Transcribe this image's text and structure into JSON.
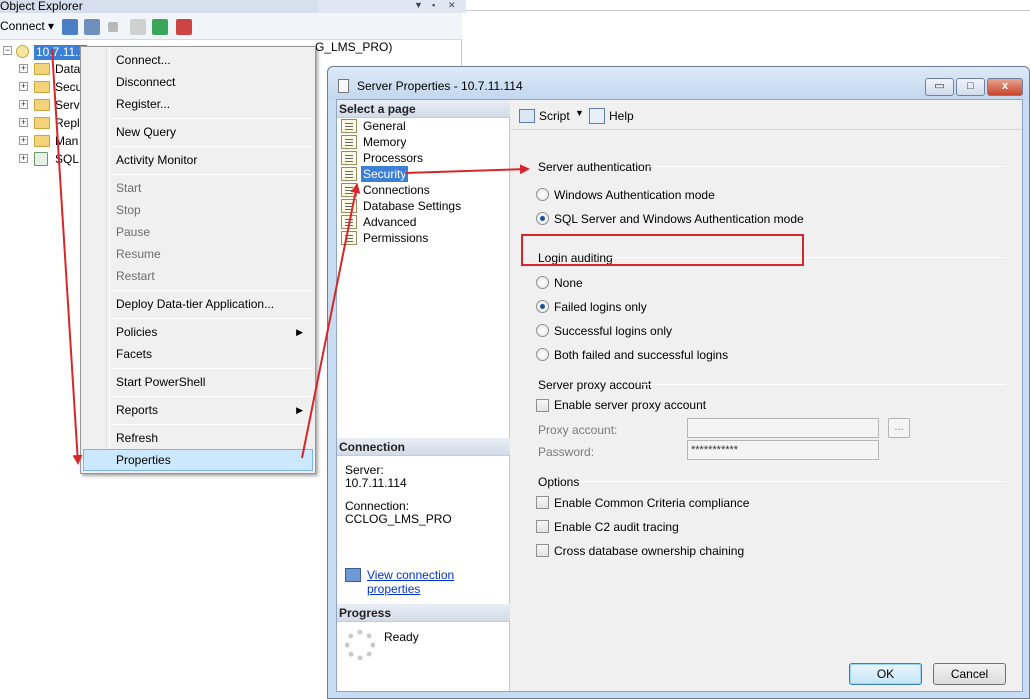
{
  "object_explorer": {
    "title": "Object Explorer",
    "toolbar": {
      "connect_label": "Connect"
    },
    "server_node": "10.7.11.1",
    "server_node_suffix": "G_LMS_PRO)",
    "tree_items": [
      "Data",
      "Secu",
      "Serve",
      "Repl",
      "Man",
      "SQL"
    ]
  },
  "context_menu": {
    "items": [
      {
        "label": "Connect...",
        "disabled": false
      },
      {
        "label": "Disconnect",
        "disabled": false
      },
      {
        "label": "Register...",
        "disabled": false
      },
      {
        "label": "New Query",
        "disabled": false
      },
      {
        "label": "Activity Monitor",
        "disabled": false
      },
      {
        "label": "Start",
        "disabled": true
      },
      {
        "label": "Stop",
        "disabled": true
      },
      {
        "label": "Pause",
        "disabled": true
      },
      {
        "label": "Resume",
        "disabled": true
      },
      {
        "label": "Restart",
        "disabled": true
      },
      {
        "label": "Deploy Data-tier Application...",
        "disabled": false
      },
      {
        "label": "Policies",
        "disabled": false
      },
      {
        "label": "Facets",
        "disabled": false
      },
      {
        "label": "Start PowerShell",
        "disabled": false
      },
      {
        "label": "Reports",
        "disabled": false
      },
      {
        "label": "Refresh",
        "disabled": false
      },
      {
        "label": "Properties",
        "disabled": false,
        "highlighted": true
      }
    ]
  },
  "dialog": {
    "title": "Server Properties - 10.7.11.114",
    "window_buttons": {
      "minimize": "▭",
      "maximize": "□",
      "close": "x"
    },
    "select_page_header": "Select a page",
    "pages": [
      "General",
      "Memory",
      "Processors",
      "Security",
      "Connections",
      "Database Settings",
      "Advanced",
      "Permissions"
    ],
    "selected_page": "Security",
    "connection": {
      "header": "Connection",
      "server_label": "Server:",
      "server_value": "10.7.11.114",
      "connection_label": "Connection:",
      "connection_value": "CCLOG_LMS_PRO",
      "view_link": "View connection properties"
    },
    "progress": {
      "header": "Progress",
      "status": "Ready"
    },
    "toolbar": {
      "script_label": "Script",
      "help_label": "Help"
    },
    "server_authentication": {
      "title": "Server authentication",
      "options": [
        "Windows Authentication mode",
        "SQL Server and Windows Authentication mode"
      ],
      "selected": 1
    },
    "login_auditing": {
      "title": "Login auditing",
      "options": [
        "None",
        "Failed logins only",
        "Successful logins only",
        "Both failed and successful logins"
      ],
      "selected": 1
    },
    "proxy": {
      "title": "Server proxy account",
      "enable_label": "Enable server proxy account",
      "proxy_account_label": "Proxy account:",
      "password_label": "Password:",
      "password_value": "***********",
      "browse_label": "..."
    },
    "options": {
      "title": "Options",
      "items": [
        "Enable Common Criteria compliance",
        "Enable C2 audit tracing",
        "Cross database ownership chaining"
      ]
    },
    "buttons": {
      "ok": "OK",
      "cancel": "Cancel"
    }
  },
  "colors": {
    "annotation_red": "#d9262c",
    "selection_blue": "#3c7fd6"
  }
}
